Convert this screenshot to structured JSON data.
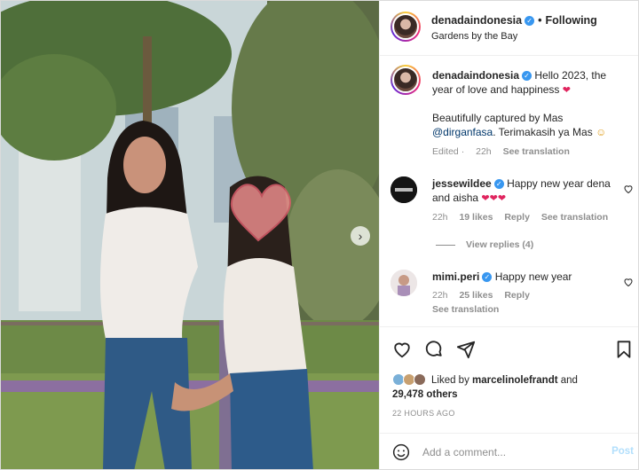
{
  "post": {
    "username": "denadaindonesia",
    "follow_state": "Following",
    "dot": "•",
    "location": "Gardens by the Bay"
  },
  "caption": {
    "username": "denadaindonesia",
    "text_line1": "Hello 2023, the year of love and happiness",
    "text_line2_prefix": "Beautifully captured by Mas",
    "mention": "@dirganfasa",
    "text_line2_suffix": ". Terimakasih ya Mas",
    "edited": "Edited",
    "time": "22h",
    "see_translation": "See translation"
  },
  "comments": [
    {
      "username": "jessewildee",
      "text": "Happy new year dena and aisha",
      "time": "22h",
      "likes": "19 likes",
      "reply": "Reply",
      "see_translation": "See translation",
      "view_replies": "View replies (4)"
    },
    {
      "username": "mimi.peri",
      "text": "Happy new year",
      "time": "22h",
      "likes": "25 likes",
      "reply": "Reply",
      "see_translation": "See translation"
    }
  ],
  "likes": {
    "prefix": "Liked by",
    "user": "marcelinolefrandt",
    "and": "and",
    "others": "29,478 others"
  },
  "timestamp": "22 HOURS AGO",
  "add_comment": {
    "placeholder": "Add a comment...",
    "post_label": "Post"
  },
  "icons": {
    "verified": "verified-badge-icon",
    "like": "heart-icon",
    "comment": "comment-bubble-icon",
    "share": "paper-plane-icon",
    "save": "bookmark-icon",
    "emoji": "smiley-icon",
    "next": "chevron-right-icon"
  },
  "colors": {
    "verified": "#3897f0",
    "heart_emoji": "#e0245e",
    "post_disabled": "#b2dffc",
    "mention": "#00376b"
  }
}
